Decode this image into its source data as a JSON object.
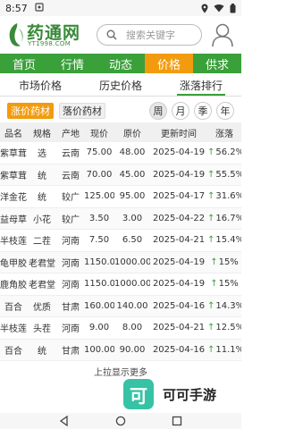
{
  "status_bar": {
    "time": "8:57"
  },
  "header": {
    "logo_text": "药通网",
    "logo_url": "YT1998.COM",
    "search_placeholder": "搜索关键字"
  },
  "nav": {
    "items": [
      {
        "label": "首页"
      },
      {
        "label": "行情"
      },
      {
        "label": "动态"
      },
      {
        "label": "价格"
      },
      {
        "label": "供求"
      }
    ],
    "active_index": 3
  },
  "market_tabs": {
    "items": [
      {
        "label": "市场价格"
      },
      {
        "label": "历史价格"
      },
      {
        "label": "涨落排行"
      }
    ],
    "active_index": 2
  },
  "filters": {
    "up_label": "涨价药材",
    "down_label": "落价药材",
    "periods": [
      {
        "label": "周"
      },
      {
        "label": "月"
      },
      {
        "label": "季"
      },
      {
        "label": "年"
      }
    ],
    "active_period_index": 0
  },
  "table": {
    "headers": [
      "品名",
      "规格",
      "产地",
      "现价",
      "原价",
      "更新时间",
      "涨落"
    ],
    "arrow_glyph": "↑",
    "rows": [
      {
        "name": "紫草茸",
        "spec": "选",
        "origin": "云南",
        "current": "75.00",
        "original": "48.00",
        "date": "2025-04-19",
        "change": "56.2%"
      },
      {
        "name": "紫草茸",
        "spec": "统",
        "origin": "云南",
        "current": "70.00",
        "original": "45.00",
        "date": "2025-04-19",
        "change": "55.5%"
      },
      {
        "name": "洋金花",
        "spec": "统",
        "origin": "较广",
        "current": "125.00",
        "original": "95.00",
        "date": "2025-04-17",
        "change": "31.6%"
      },
      {
        "name": "益母草",
        "spec": "小花",
        "origin": "较广",
        "current": "3.50",
        "original": "3.00",
        "date": "2025-04-22",
        "change": "16.7%"
      },
      {
        "name": "半枝莲",
        "spec": "二茬",
        "origin": "河南",
        "current": "7.50",
        "original": "6.50",
        "date": "2025-04-21",
        "change": "15.4%"
      },
      {
        "name": "龟甲胶",
        "spec": "老君堂",
        "origin": "河南",
        "current": "1150.00",
        "original": "1000.00",
        "date": "2025-04-19",
        "change": "15%"
      },
      {
        "name": "鹿角胶",
        "spec": "老君堂",
        "origin": "河南",
        "current": "1150.00",
        "original": "1000.00",
        "date": "2025-04-19",
        "change": "15%"
      },
      {
        "name": "百合",
        "spec": "优质",
        "origin": "甘肃",
        "current": "160.00",
        "original": "140.00",
        "date": "2025-04-16",
        "change": "14.3%"
      },
      {
        "name": "半枝莲",
        "spec": "头茬",
        "origin": "河南",
        "current": "9.00",
        "original": "8.00",
        "date": "2025-04-21",
        "change": "12.5%"
      },
      {
        "name": "百合",
        "spec": "统",
        "origin": "甘肃",
        "current": "100.00",
        "original": "90.00",
        "date": "2025-04-16",
        "change": "11.1%"
      }
    ]
  },
  "load_more": "上拉显示更多",
  "watermark": {
    "badge": "可",
    "text": "可可手游"
  },
  "colors": {
    "brand_green": "#3aa03a",
    "accent_orange": "#f29b0f",
    "watermark_teal": "#36c3a5"
  }
}
